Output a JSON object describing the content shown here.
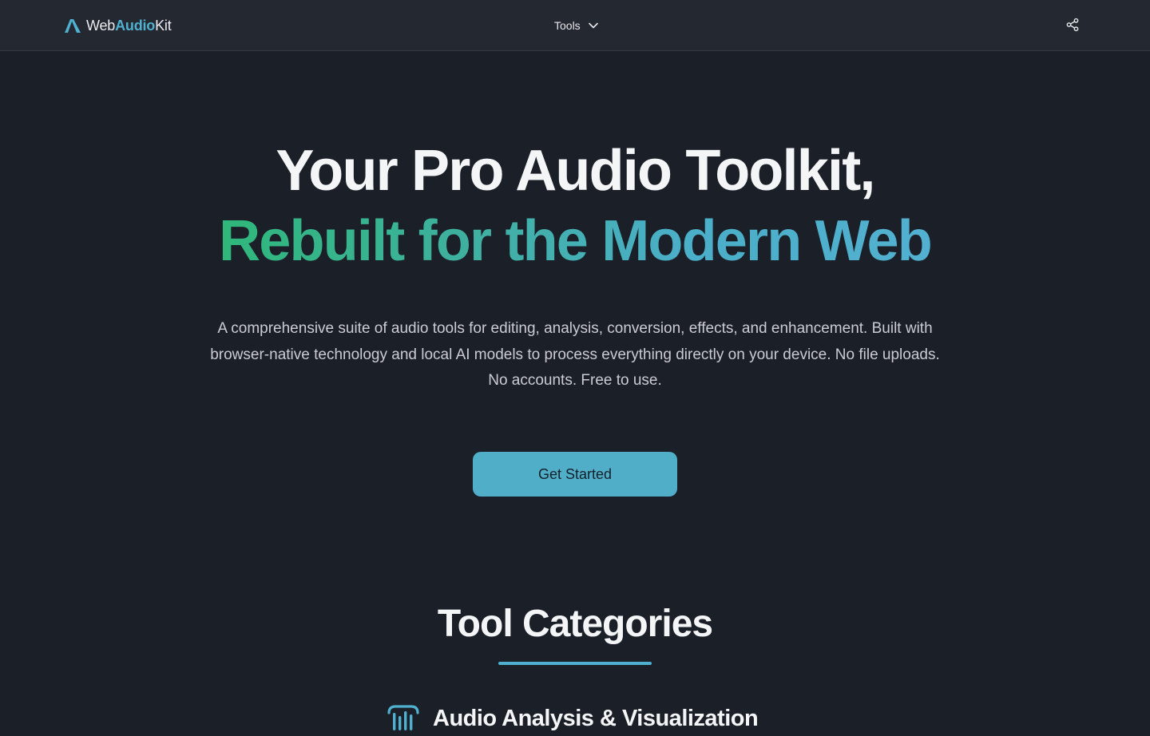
{
  "nav": {
    "brand_prefix": "Web",
    "brand_accent": "Audio",
    "brand_suffix": "Kit",
    "tools_label": "Tools",
    "logo_icon": "waveform-a-logo",
    "menu_icon": "chevron-down-icon",
    "share_icon": "share-icon"
  },
  "hero": {
    "title_line1": "Your Pro Audio Toolkit,",
    "title_line2": "Rebuilt for the Modern Web",
    "description": "A comprehensive suite of audio tools for editing, analysis, conversion, effects, and enhancement. Built with browser-native technology and local AI models to process everything directly on your device. No file uploads. No accounts. Free to use.",
    "cta_label": "Get Started"
  },
  "categories": {
    "title": "Tool Categories",
    "items": [
      {
        "title": "Audio Analysis & Visualization",
        "icon": "equalizer-bars-icon"
      }
    ]
  },
  "colors": {
    "background": "#1b1f27",
    "navbar": "#242830",
    "accent": "#4fb0cf",
    "gradient_start": "#2fb77a",
    "gradient_end": "#52b0d0",
    "cta": "#51aec8"
  }
}
